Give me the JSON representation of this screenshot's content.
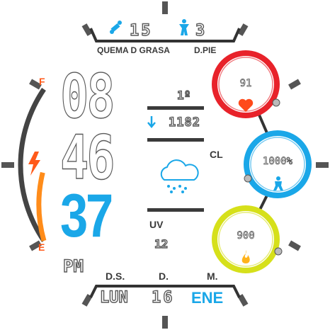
{
  "top": {
    "calories_icon": "flame-dumbbell-icon",
    "calories_value": "15",
    "steps_icon": "figure-icon",
    "steps_value": "3",
    "calories_label": "QUEMA D GRASA",
    "distance_label": "D.PIE"
  },
  "time": {
    "hour": "08",
    "minute": "46",
    "second": "37",
    "ampm": "PM"
  },
  "weather": {
    "temperature": "1º",
    "pressure": "1182",
    "condition_code": "CL",
    "uv_label": "UV",
    "uv_value": "12",
    "icon": "cloud-rain-icon"
  },
  "battery": {
    "top_marker": "F",
    "bottom_marker": "E",
    "icon": "lightning-icon",
    "level": 0.45,
    "fill_color": "#ff8c1a"
  },
  "rings": {
    "heart": {
      "value": "91",
      "icon": "heart-icon",
      "color": "#e8222a",
      "progress": 0.85
    },
    "steps": {
      "value": "1000%",
      "icon": "walker-icon",
      "color": "#1aa7e8",
      "progress": 0.8
    },
    "calories": {
      "value": "900",
      "icon": "flame-icon",
      "color": "#d6e01a",
      "progress": 0.75
    }
  },
  "bottom": {
    "week_label": "D.S.",
    "day_label": "D.",
    "month_label": "M.",
    "weekday": "LUN",
    "day": "16",
    "month": "ENE",
    "accent": "#1aa7e8"
  }
}
